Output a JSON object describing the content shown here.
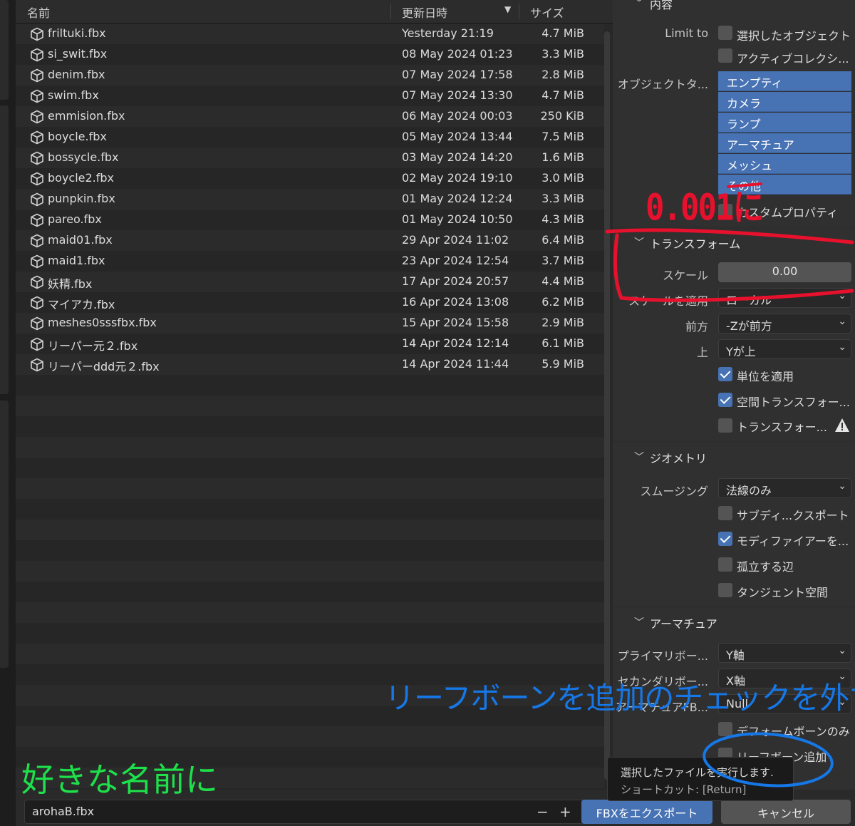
{
  "columns": {
    "name": "名前",
    "modified": "更新日時",
    "size": "サイズ"
  },
  "files": [
    {
      "name": "friltuki.fbx",
      "date": "Yesterday 21:19",
      "size": "4.7 MiB"
    },
    {
      "name": "si_swit.fbx",
      "date": "08 May 2024 01:23",
      "size": "3.3 MiB"
    },
    {
      "name": "denim.fbx",
      "date": "07 May 2024 17:58",
      "size": "2.8 MiB"
    },
    {
      "name": "swim.fbx",
      "date": "07 May 2024 13:30",
      "size": "4.7 MiB"
    },
    {
      "name": "emmision.fbx",
      "date": "06 May 2024 00:03",
      "size": "250 KiB"
    },
    {
      "name": "boycle.fbx",
      "date": "05 May 2024 13:44",
      "size": "7.5 MiB"
    },
    {
      "name": "bossycle.fbx",
      "date": "03 May 2024 14:20",
      "size": "1.6 MiB"
    },
    {
      "name": "boycle2.fbx",
      "date": "02 May 2024 19:10",
      "size": "3.0 MiB"
    },
    {
      "name": "punpkin.fbx",
      "date": "01 May 2024 12:24",
      "size": "3.3 MiB"
    },
    {
      "name": "pareo.fbx",
      "date": "01 May 2024 10:50",
      "size": "4.3 MiB"
    },
    {
      "name": "maid01.fbx",
      "date": "29 Apr 2024 11:02",
      "size": "6.4 MiB"
    },
    {
      "name": "maid1.fbx",
      "date": "23 Apr 2024 12:54",
      "size": "3.7 MiB"
    },
    {
      "name": "妖精.fbx",
      "date": "17 Apr 2024 20:57",
      "size": "4.4 MiB"
    },
    {
      "name": "マイアカ.fbx",
      "date": "16 Apr 2024 13:08",
      "size": "6.2 MiB"
    },
    {
      "name": "meshes0sssfbx.fbx",
      "date": "15 Apr 2024 15:58",
      "size": "2.9 MiB"
    },
    {
      "name": "リーパー元２.fbx",
      "date": "14 Apr 2024 12:14",
      "size": "6.1 MiB"
    },
    {
      "name": "リーパーddd元２.fbx",
      "date": "14 Apr 2024 11:44",
      "size": "5.9 MiB"
    }
  ],
  "sidebar": {
    "include": {
      "title": "内容",
      "limit_to_label": "Limit to",
      "selected_objects": {
        "label": "選択したオブジェクト",
        "checked": false
      },
      "active_collection": {
        "label": "アクティブコレクシ...",
        "checked": false
      },
      "object_types_label": "オブジェクトタ...",
      "object_types": [
        "エンプティ",
        "カメラ",
        "ランプ",
        "アーマチュア",
        "メッシュ",
        "その他"
      ],
      "custom_properties": {
        "label": "カスタムプロパティ",
        "checked": false
      }
    },
    "transform": {
      "title": "トランスフォーム",
      "scale_label": "スケール",
      "scale_value": "0.00",
      "apply_scaling_label": "スケールを適用",
      "apply_scaling_value": "ローカル",
      "forward_label": "前方",
      "forward_value": "-Zが前方",
      "up_label": "上",
      "up_value": "Yが上",
      "apply_unit": {
        "label": "単位を適用",
        "checked": true
      },
      "use_space_transform": {
        "label": "空間トランスフォー...",
        "checked": true
      },
      "apply_transform": {
        "label": "トランスフォー...",
        "checked": false
      }
    },
    "geometry": {
      "title": "ジオメトリ",
      "smoothing_label": "スムージング",
      "smoothing_value": "法線のみ",
      "subdivision": {
        "label": "サブディ...クスポート",
        "checked": false
      },
      "apply_modifiers": {
        "label": "モディファイアーを...",
        "checked": true
      },
      "loose_edges": {
        "label": "孤立する辺",
        "checked": false
      },
      "tangent_space": {
        "label": "タンジェント空間",
        "checked": false
      }
    },
    "armature": {
      "title": "アーマチュア",
      "primary_bone_label": "プライマリボー...",
      "primary_bone_value": "Y軸",
      "secondary_bone_label": "セカンダリボー...",
      "secondary_bone_value": "X軸",
      "armature_fbx_label": "アーマチュアFB...",
      "armature_fbx_value": "Null",
      "deform_only": {
        "label": "デフォームボーンのみ",
        "checked": false
      },
      "add_leaf_bones": {
        "label": "リーフボーン追加",
        "checked": false
      }
    }
  },
  "bottom": {
    "filename": "arohaB.fbx",
    "minus": "−",
    "plus": "+",
    "export_label": "FBXをエクスポート",
    "cancel_label": "キャンセル"
  },
  "tooltip": {
    "line1": "選択したファイルを実行します.",
    "line2": "ショートカット: [Return]"
  },
  "annotations": {
    "scale_note": "0.001に",
    "leaf_bone_note": "リーフボーンを追加のチェックを外す",
    "filename_note": "好きな名前に",
    "red_color": "#e8112d",
    "blue_color": "#1677e6",
    "green_color": "#1ee04a"
  },
  "colors": {
    "accent": "#4772b3",
    "panel_bg": "#303030",
    "list_bg": "#282828"
  }
}
